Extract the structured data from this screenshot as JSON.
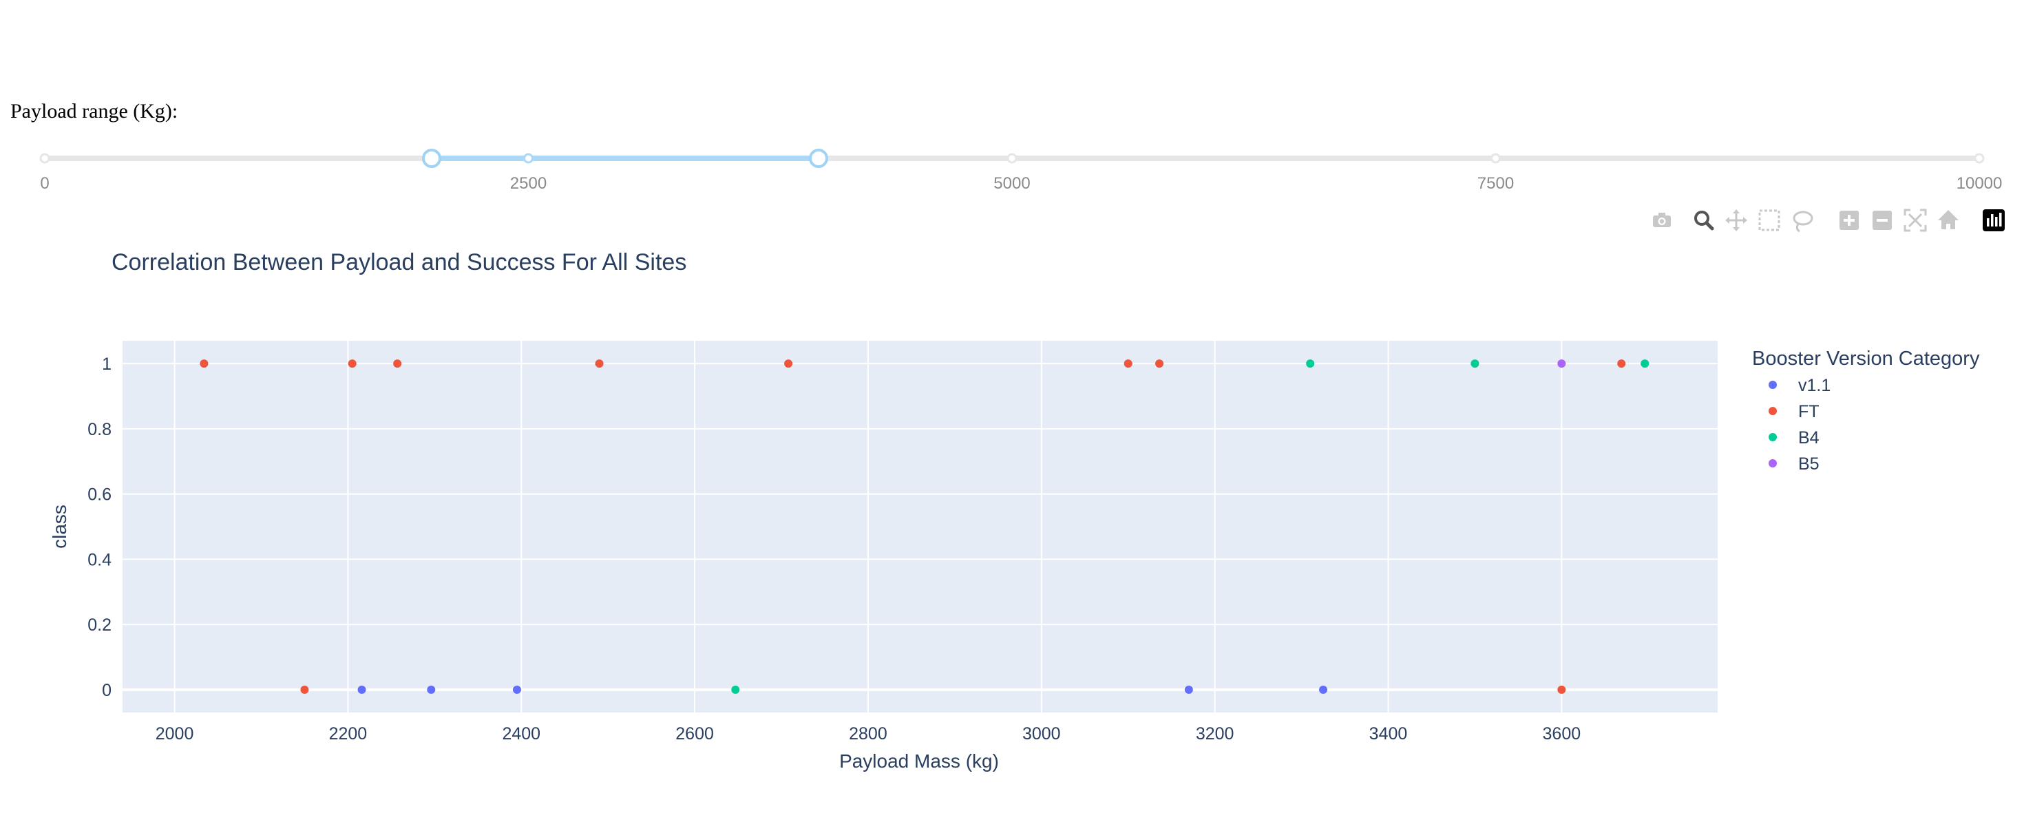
{
  "slider": {
    "label": "Payload range (Kg):",
    "min": 0,
    "max": 10000,
    "range": [
      2000,
      4000
    ],
    "marks": [
      "0",
      "2500",
      "5000",
      "7500",
      "10000"
    ],
    "mark_values": [
      0,
      2500,
      5000,
      7500,
      10000
    ],
    "track_color": "#e6e6e6",
    "active_color": "#abd8f7",
    "handle_color": "#9fd3f6"
  },
  "toolbar": {
    "icons": [
      "camera-icon",
      "zoom-icon",
      "pan-icon",
      "box-select-icon",
      "lasso-select-icon",
      "zoom-in-icon",
      "zoom-out-icon",
      "autoscale-icon",
      "reset-axes-icon",
      "plotly-logo-icon"
    ]
  },
  "chart_data": {
    "type": "scatter",
    "title": "Correlation Between Payload and Success For All Sites",
    "xlabel": "Payload Mass (kg)",
    "ylabel": "class",
    "xlim": [
      1940,
      3780
    ],
    "ylim": [
      -0.07,
      1.07
    ],
    "xticks": [
      2000,
      2200,
      2400,
      2600,
      2800,
      3000,
      3200,
      3400,
      3600
    ],
    "yticks": [
      0,
      0.2,
      0.4,
      0.6,
      0.8,
      1
    ],
    "ytick_labels": [
      "0",
      "0.2",
      "0.4",
      "0.6",
      "0.8",
      "1"
    ],
    "grid": true,
    "background": "#e5ecf6",
    "legend_title": "Booster Version Category",
    "legend_position": "right",
    "series": [
      {
        "name": "v1.1",
        "color": "#636efa",
        "points": [
          [
            2216,
            0
          ],
          [
            2296,
            0
          ],
          [
            2395,
            0
          ],
          [
            3170,
            0
          ],
          [
            3325,
            0
          ]
        ]
      },
      {
        "name": "FT",
        "color": "#ef553b",
        "points": [
          [
            2034,
            1
          ],
          [
            2205,
            1
          ],
          [
            2257,
            1
          ],
          [
            2490,
            1
          ],
          [
            2708,
            1
          ],
          [
            3100,
            1
          ],
          [
            3136,
            1
          ],
          [
            3669,
            1
          ],
          [
            2150,
            0
          ],
          [
            3600,
            0
          ]
        ]
      },
      {
        "name": "B4",
        "color": "#00cc96",
        "points": [
          [
            3310,
            1
          ],
          [
            3500,
            1
          ],
          [
            3696,
            1
          ],
          [
            2647,
            0
          ]
        ]
      },
      {
        "name": "B5",
        "color": "#ab63fa",
        "points": [
          [
            3600,
            1
          ]
        ]
      }
    ]
  }
}
